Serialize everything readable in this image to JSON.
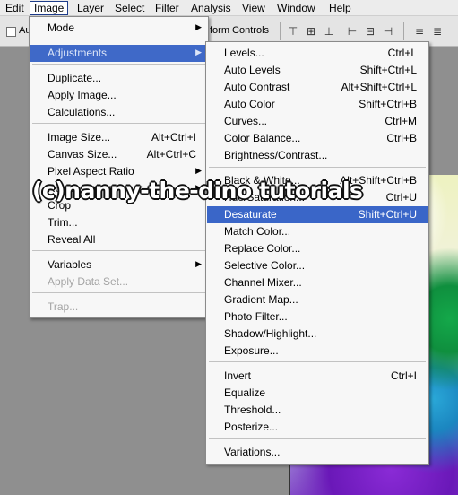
{
  "menubar": {
    "items": [
      {
        "label": "Edit"
      },
      {
        "label": "Image"
      },
      {
        "label": "Layer"
      },
      {
        "label": "Select"
      },
      {
        "label": "Filter"
      },
      {
        "label": "Analysis"
      },
      {
        "label": "View"
      },
      {
        "label": "Window"
      },
      {
        "label": "Help"
      }
    ]
  },
  "options_bar": {
    "auto_label": "Au",
    "transform_label": "form Controls"
  },
  "image_menu": {
    "items": [
      {
        "label": "Mode",
        "shortcut": "",
        "submenu": true
      },
      {
        "label": "Adjustments",
        "shortcut": "",
        "submenu": true
      },
      {
        "label": "Duplicate...",
        "shortcut": ""
      },
      {
        "label": "Apply Image...",
        "shortcut": ""
      },
      {
        "label": "Calculations...",
        "shortcut": ""
      },
      {
        "label": "Image Size...",
        "shortcut": "Alt+Ctrl+I"
      },
      {
        "label": "Canvas Size...",
        "shortcut": "Alt+Ctrl+C"
      },
      {
        "label": "Pixel Aspect Ratio",
        "shortcut": "",
        "submenu": true
      },
      {
        "label": "Rotate Canvas",
        "shortcut": "",
        "submenu": true
      },
      {
        "label": "Crop",
        "shortcut": ""
      },
      {
        "label": "Trim...",
        "shortcut": ""
      },
      {
        "label": "Reveal All",
        "shortcut": ""
      },
      {
        "label": "Variables",
        "shortcut": "",
        "submenu": true
      },
      {
        "label": "Apply Data Set...",
        "shortcut": ""
      },
      {
        "label": "Trap...",
        "shortcut": ""
      }
    ]
  },
  "adjustments_menu": {
    "items": [
      {
        "label": "Levels...",
        "shortcut": "Ctrl+L"
      },
      {
        "label": "Auto Levels",
        "shortcut": "Shift+Ctrl+L"
      },
      {
        "label": "Auto Contrast",
        "shortcut": "Alt+Shift+Ctrl+L"
      },
      {
        "label": "Auto Color",
        "shortcut": "Shift+Ctrl+B"
      },
      {
        "label": "Curves...",
        "shortcut": "Ctrl+M"
      },
      {
        "label": "Color Balance...",
        "shortcut": "Ctrl+B"
      },
      {
        "label": "Brightness/Contrast...",
        "shortcut": ""
      },
      {
        "label": "Black & White...",
        "shortcut": "Alt+Shift+Ctrl+B"
      },
      {
        "label": "Hue/Saturation...",
        "shortcut": "Ctrl+U"
      },
      {
        "label": "Desaturate",
        "shortcut": "Shift+Ctrl+U"
      },
      {
        "label": "Match Color...",
        "shortcut": ""
      },
      {
        "label": "Replace Color...",
        "shortcut": ""
      },
      {
        "label": "Selective Color...",
        "shortcut": ""
      },
      {
        "label": "Channel Mixer...",
        "shortcut": ""
      },
      {
        "label": "Gradient Map...",
        "shortcut": ""
      },
      {
        "label": "Photo Filter...",
        "shortcut": ""
      },
      {
        "label": "Shadow/Highlight...",
        "shortcut": ""
      },
      {
        "label": "Exposure...",
        "shortcut": ""
      },
      {
        "label": "Invert",
        "shortcut": "Ctrl+I"
      },
      {
        "label": "Equalize",
        "shortcut": ""
      },
      {
        "label": "Threshold...",
        "shortcut": ""
      },
      {
        "label": "Posterize...",
        "shortcut": ""
      },
      {
        "label": "Variations...",
        "shortcut": ""
      }
    ]
  },
  "watermark": {
    "text": "(c)nanny-the-dino tutorials"
  },
  "icons": {
    "submenu_arrow": "▶"
  },
  "colors": {
    "highlight": "#3f69c8",
    "menubar_active_border": "#1e3d8a"
  }
}
